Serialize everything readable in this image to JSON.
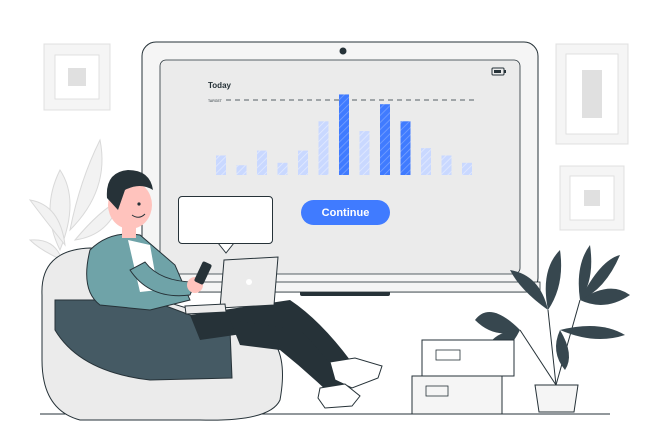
{
  "screen": {
    "title": "Today",
    "target_line_label": "TARGET",
    "continue_label": "Continue",
    "battery_icon": "battery-icon"
  },
  "chart_data": {
    "type": "bar",
    "title": "Today",
    "values": [
      4,
      2,
      5,
      2.5,
      5,
      11,
      16.5,
      9,
      14.5,
      11,
      5.5,
      4,
      2.5
    ],
    "highlighted": [
      false,
      false,
      false,
      false,
      false,
      false,
      true,
      false,
      true,
      true,
      false,
      false,
      false
    ],
    "ylim": [
      0,
      17
    ],
    "target": 15.5,
    "colors": {
      "highlight": "#407bff",
      "muted": "#c9d8ff"
    }
  },
  "colors": {
    "accent": "#407bff",
    "dark": "#263238",
    "teal_shirt": "#6fa3a8",
    "grey_light": "#ebebeb"
  }
}
